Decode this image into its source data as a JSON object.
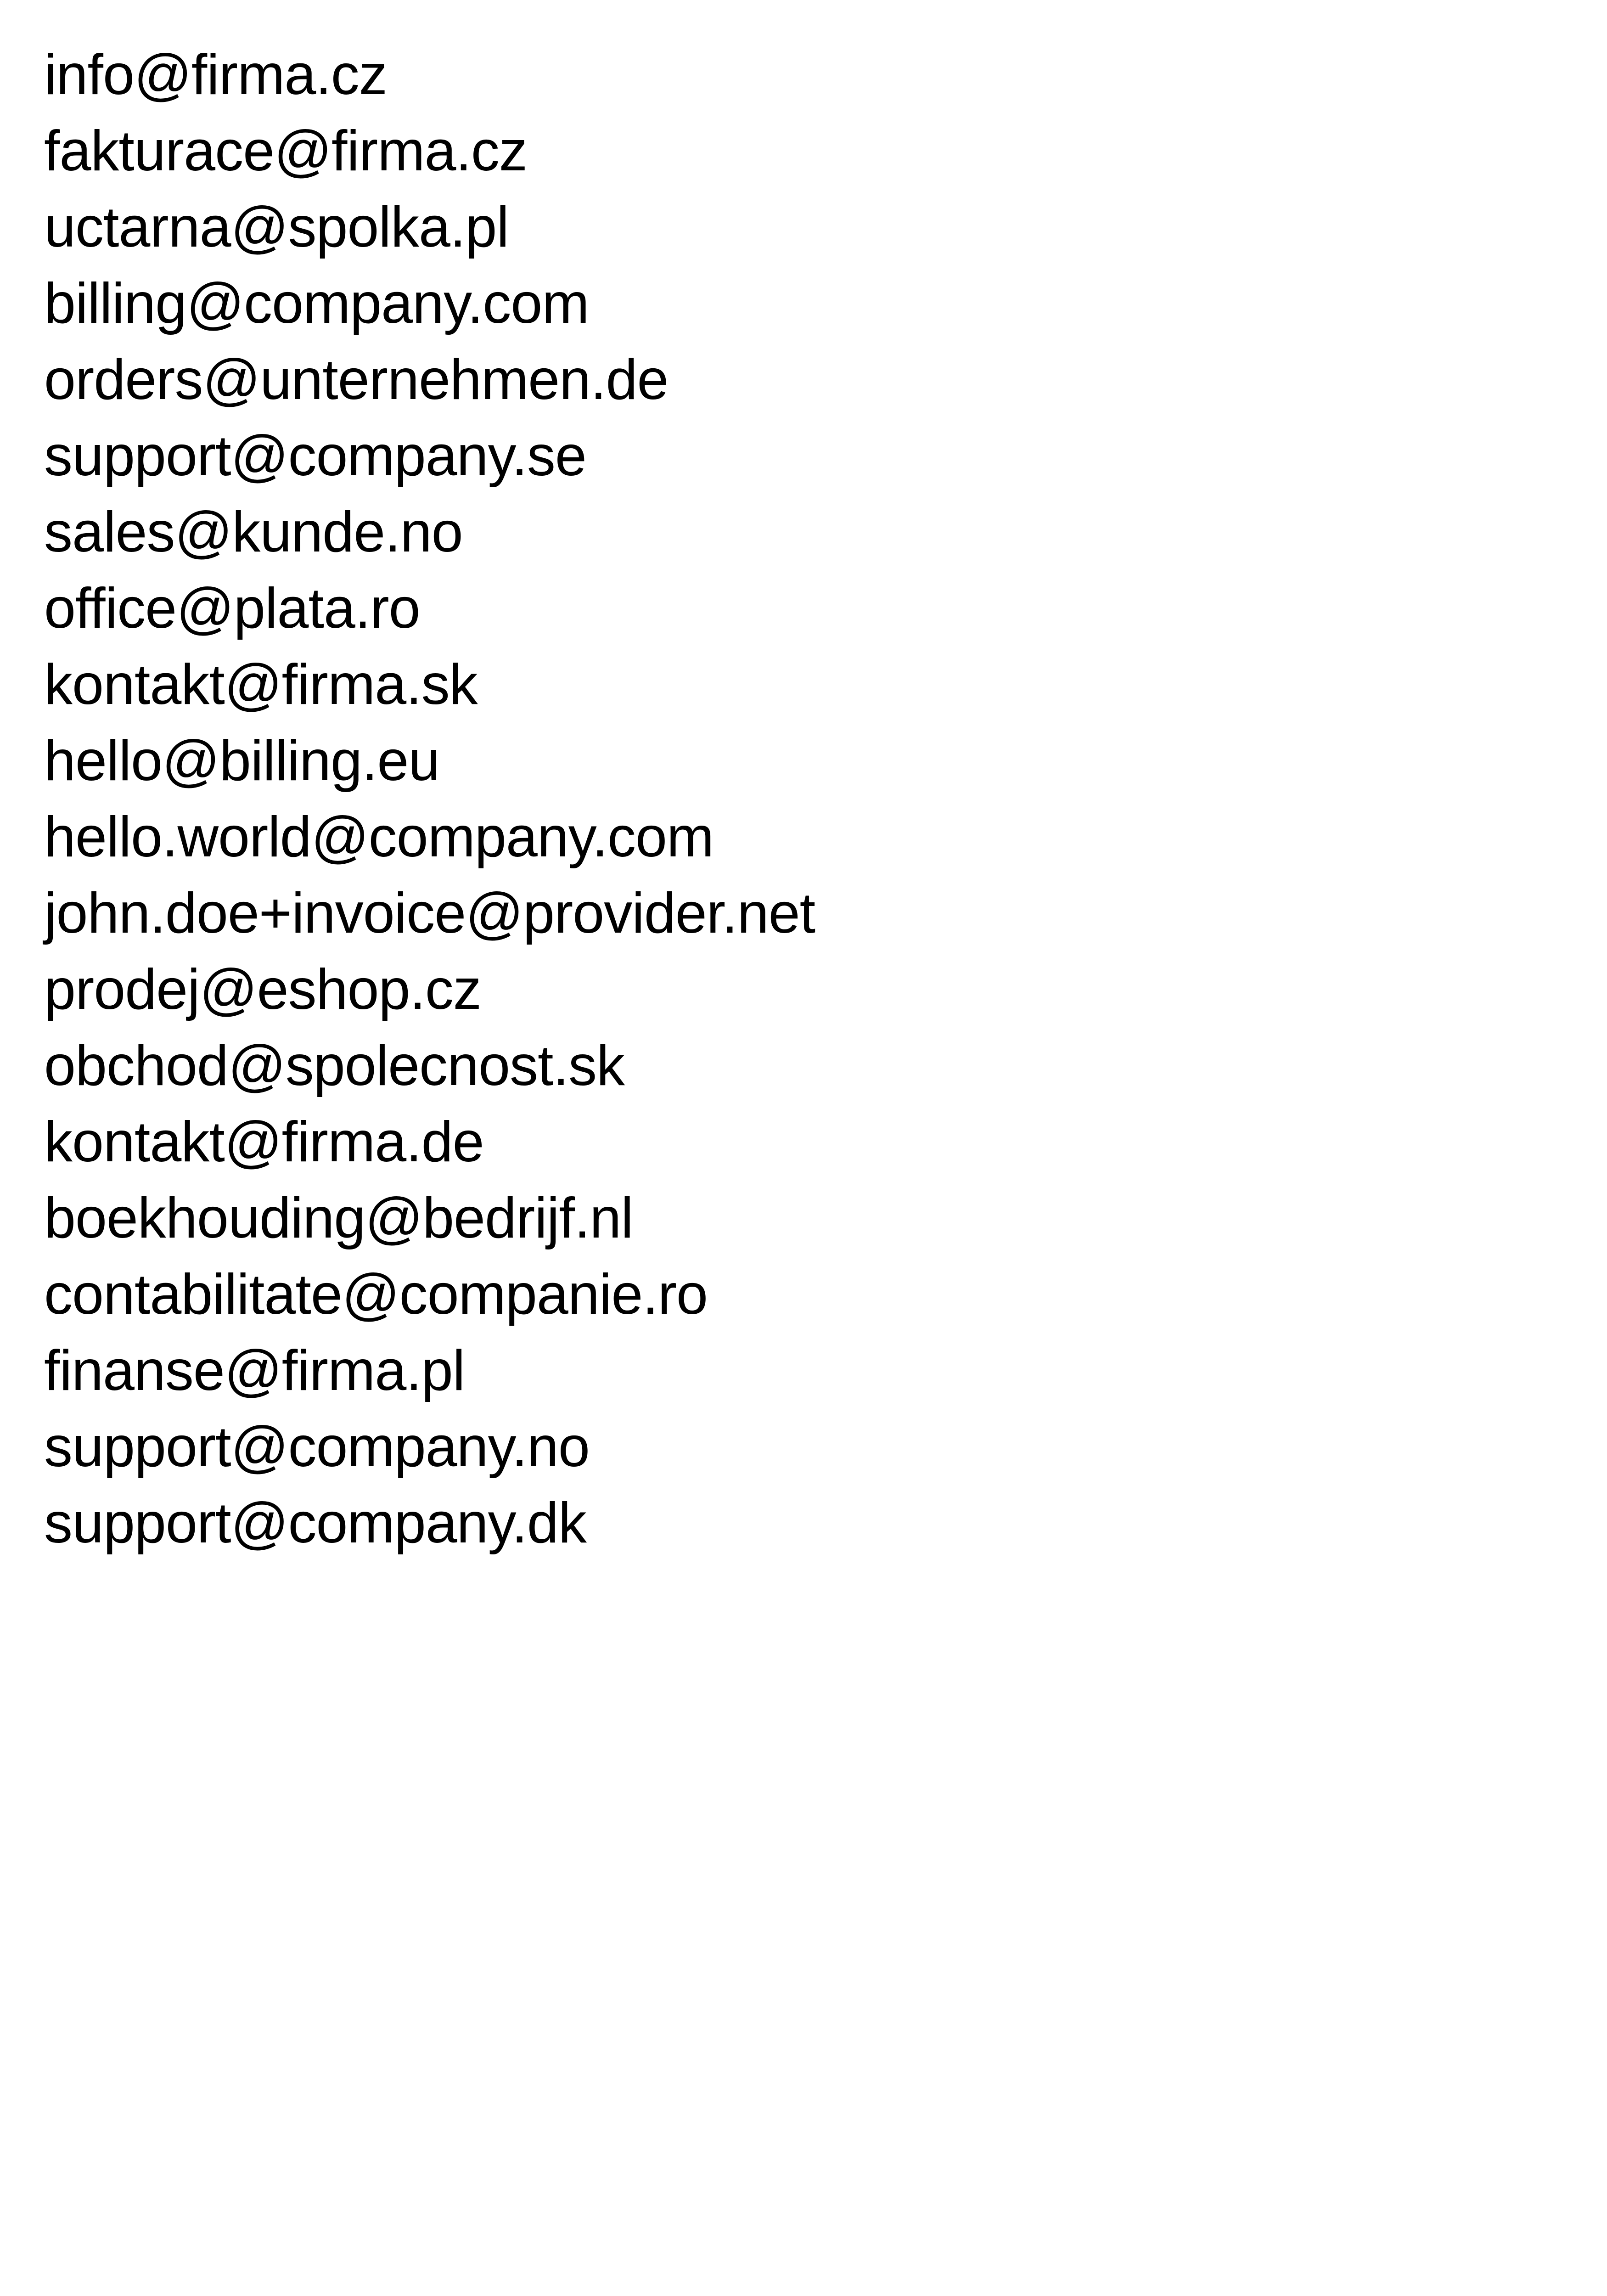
{
  "document": {
    "emails": [
      "info@firma.cz",
      "fakturace@firma.cz",
      "uctarna@spolka.pl",
      "billing@company.com",
      "orders@unternehmen.de",
      "support@company.se",
      "sales@kunde.no",
      "office@plata.ro",
      "kontakt@firma.sk",
      "hello@billing.eu",
      "hello.world@company.com",
      "john.doe+invoice@provider.net",
      "prodej@eshop.cz",
      "obchod@spolecnost.sk",
      "kontakt@firma.de",
      "boekhouding@bedrijf.nl",
      "contabilitate@companie.ro",
      "finanse@firma.pl",
      "support@company.no",
      "support@company.dk"
    ]
  }
}
